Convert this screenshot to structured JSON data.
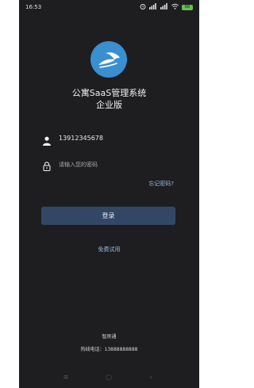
{
  "status_bar": {
    "time": "16:53",
    "alarm_icon": "alarm-icon",
    "signal1_label": "4G",
    "signal2_label": "4G",
    "wifi_icon": "wifi-icon",
    "battery": "68"
  },
  "app": {
    "logo_icon": "horse-logo-icon",
    "title_line1": "公寓SaaS管理系统",
    "title_line2": "企业版",
    "accent": "#3a8fd0"
  },
  "form": {
    "phone_icon": "user-icon",
    "phone_value": "13912345678",
    "password_icon": "lock-icon",
    "password_placeholder": "请输入您的密码",
    "forgot_label": "忘记密码?",
    "login_label": "登录",
    "login_color": "#324766"
  },
  "trial_label": "免费试用",
  "footer": {
    "company": "智房通",
    "hotline": "热线电话：13888888888"
  },
  "nav": {
    "menu_icon": "≡",
    "home_icon": "○",
    "back_icon": "‹"
  }
}
